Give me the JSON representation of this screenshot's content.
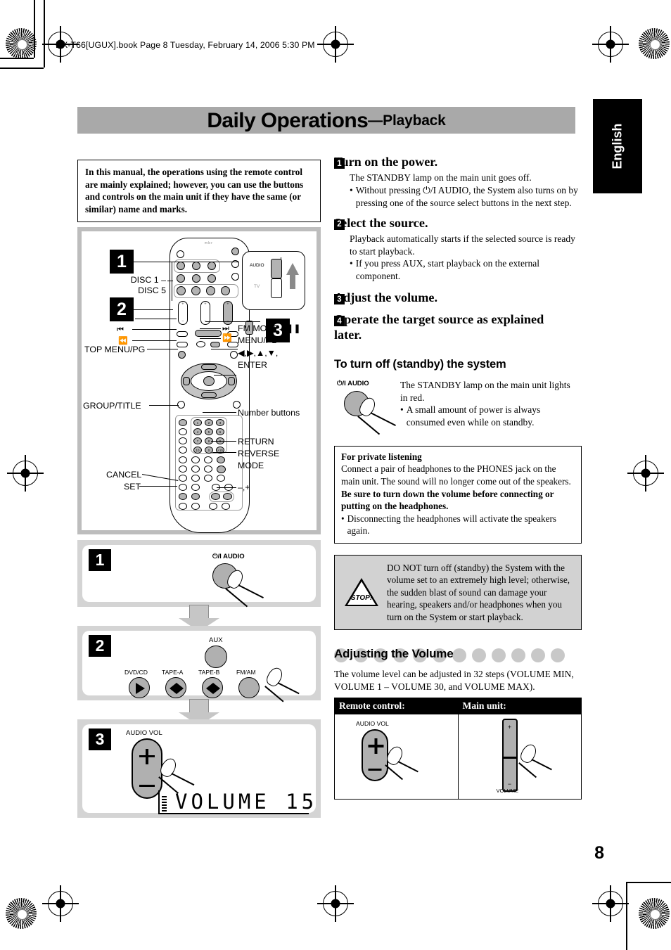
{
  "file_header": "DX-T66[UGUX].book  Page 8  Tuesday, February 14, 2006  5:30 PM",
  "page_number": "8",
  "language_tab": "English",
  "title": {
    "main": "Daily Operations",
    "dash": "—",
    "sub": "Playback"
  },
  "notice": "In this manual, the operations using the remote control are mainly explained; however, you can use the buttons and controls on the main unit if they have the same (or similar) name and marks.",
  "remote_diagram": {
    "brand": "mbr",
    "badges": [
      "1",
      "2",
      "3"
    ],
    "labels_left": [
      "DISC 1 –",
      "DISC 5",
      "TOP MENU/PG",
      "GROUP/TITLE",
      "CANCEL",
      "SET"
    ],
    "labels_right": [
      "FM MODE / ",
      "MENU/PL",
      "ENTER",
      "Number buttons",
      "RETURN",
      "REVERSE",
      "MODE",
      "–,+"
    ],
    "nav_label": "◀,▶,▲,▼,",
    "transport_icons": [
      "■",
      "⏮",
      "⏪",
      "⏭",
      "⏩"
    ],
    "callout": {
      "top": "AUDIO",
      "bottom": "TV"
    }
  },
  "step_panels": {
    "panel1": {
      "badge": "1",
      "button_label": "⏻/I AUDIO"
    },
    "panel2": {
      "badge": "2",
      "aux_label": "AUX",
      "source_buttons": [
        "DVD/CD",
        "TAPE-A",
        "TAPE-B",
        "FM/AM"
      ]
    },
    "panel3": {
      "badge": "3",
      "vol_label": "AUDIO VOL",
      "display_text": "VOLUME  15"
    }
  },
  "steps": [
    {
      "num": "1",
      "head": "Turn on the power.",
      "body": "The STANDBY lamp on the main unit goes off.",
      "bullet": "Without pressing  ⏻/I AUDIO, the System also turns on by pressing one of the source select buttons in the next step."
    },
    {
      "num": "2",
      "head": "Select the source.",
      "body": "Playback automatically starts if the selected source is ready to start playback.",
      "bullet": "If you press AUX, start playback on the external component."
    },
    {
      "num": "3",
      "head": "Adjust the volume.",
      "body": "",
      "bullet": ""
    },
    {
      "num": "4",
      "head": "Operate the target source as explained later.",
      "body": "",
      "bullet": ""
    }
  ],
  "standby": {
    "heading": "To turn off (standby) the system",
    "button_label": "⏻/I AUDIO",
    "body": "The STANDBY lamp on the main unit lights in red.",
    "bullet": "A small amount of power is always consumed even while on standby."
  },
  "private_listening": {
    "title": "For private listening",
    "text_a": "Connect a pair of headphones to the PHONES jack on the main unit. The sound will no longer come out of the speakers. ",
    "text_bold": "Be sure to turn down the volume before connecting or putting on the headphones.",
    "bullet": "Disconnecting the headphones will activate the speakers again."
  },
  "warning": {
    "icon_text": "STOP!",
    "text": "DO NOT turn off (standby) the System with the volume set to an extremely high level; otherwise, the sudden blast of sound can damage your hearing, speakers and/or headphones when you turn on the System or start playback."
  },
  "volume_section": {
    "heading": "Adjusting the Volume",
    "intro": "The volume level can be adjusted in 32 steps (VOLUME MIN, VOLUME 1 – VOLUME 30, and VOLUME MAX).",
    "table_headers": [
      "Remote control:",
      "Main unit:"
    ],
    "remote_label": "AUDIO VOL",
    "main_unit_label": "VOLUME"
  }
}
